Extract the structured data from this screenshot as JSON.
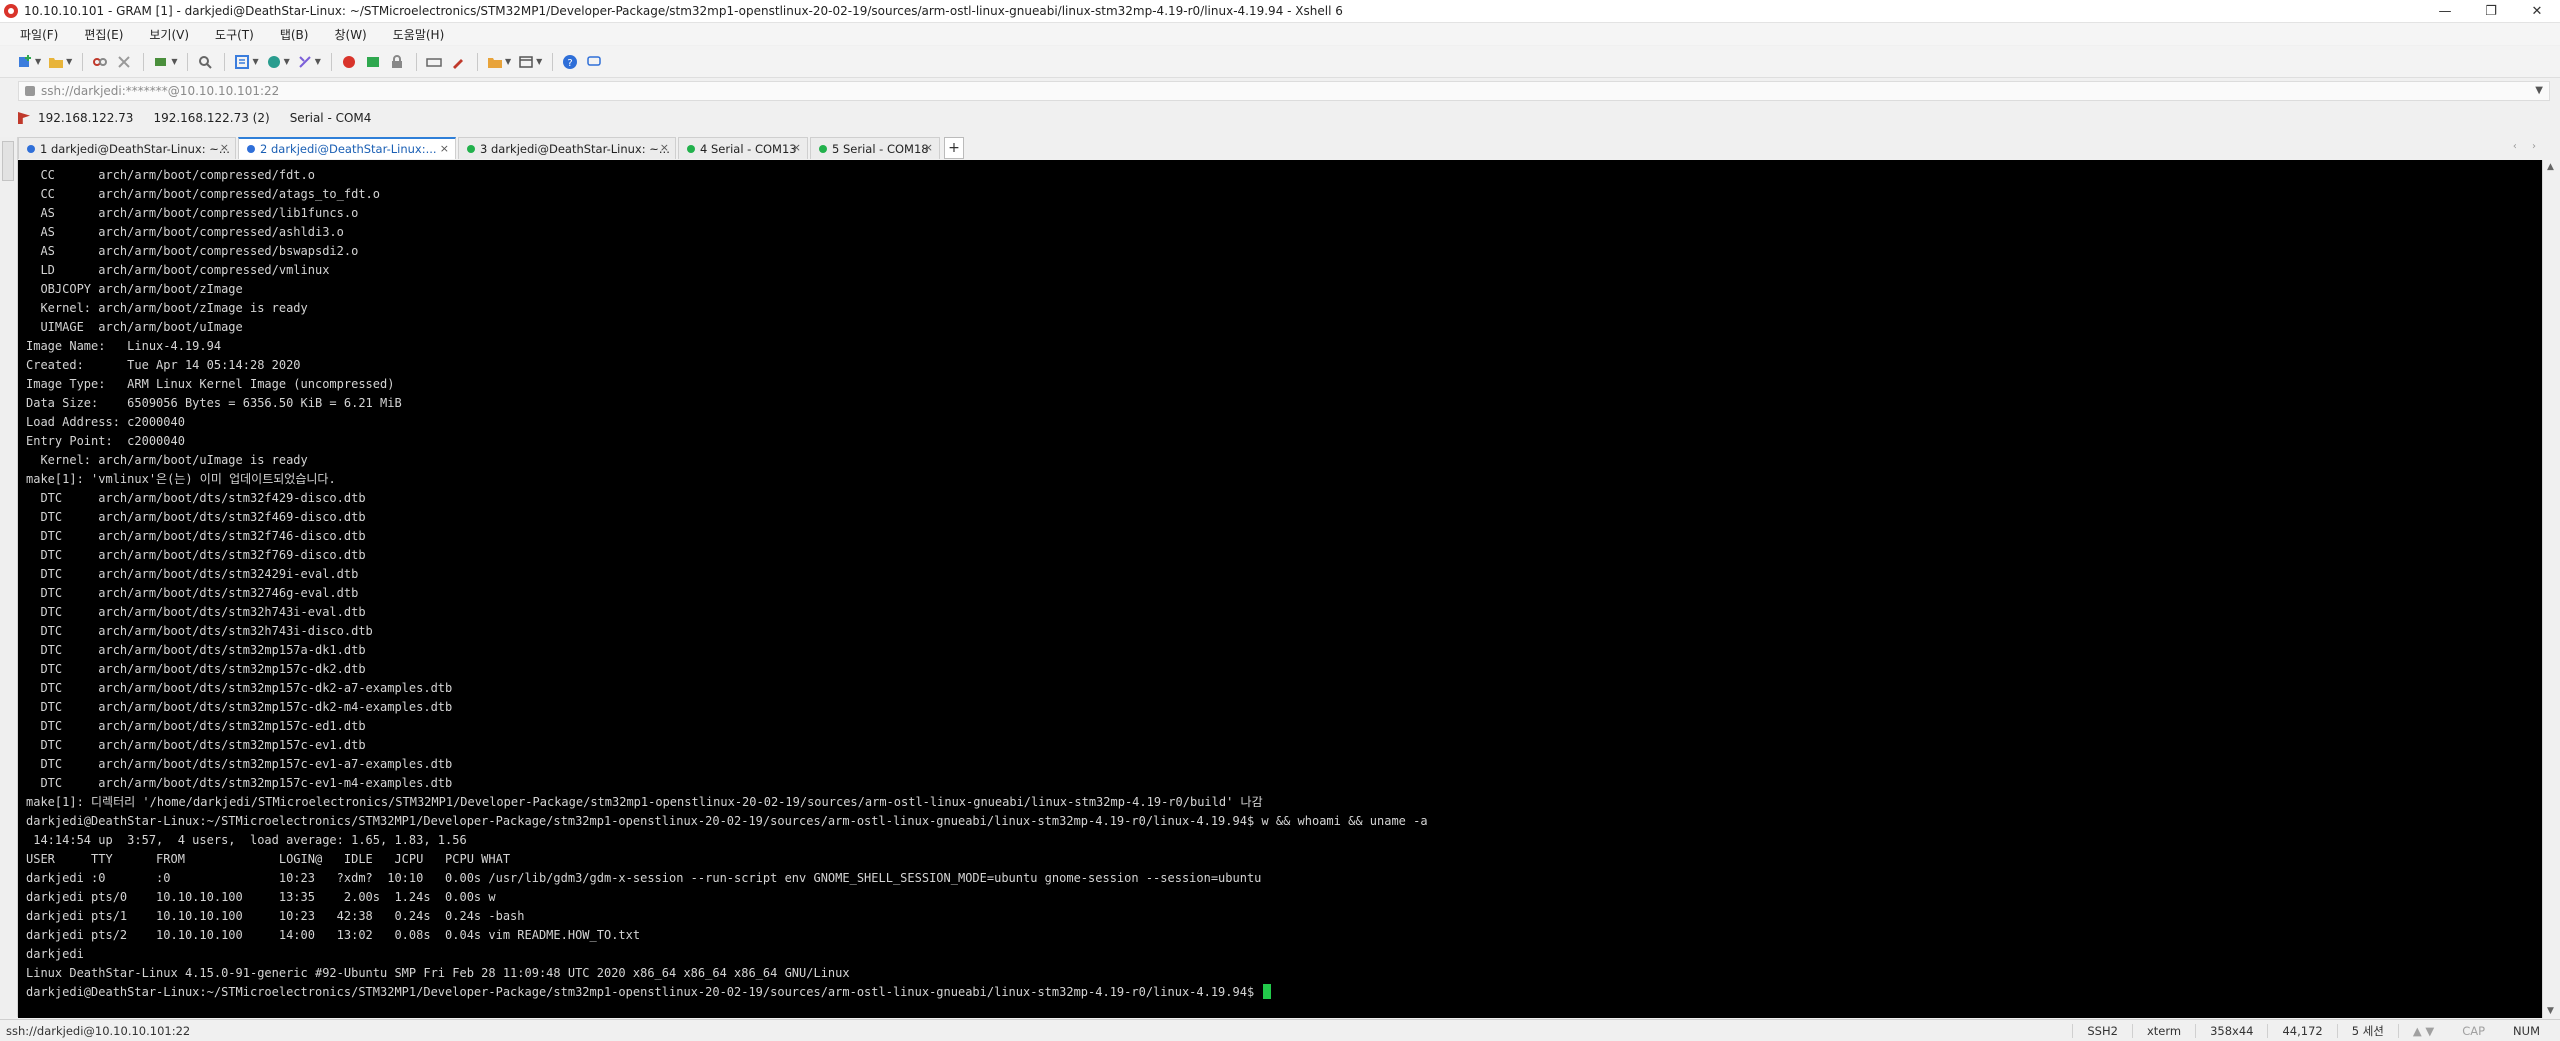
{
  "window": {
    "title": "10.10.10.101 - GRAM [1] - darkjedi@DeathStar-Linux: ~/STMicroelectronics/STM32MP1/Developer-Package/stm32mp1-openstlinux-20-02-19/sources/arm-ostl-linux-gnueabi/linux-stm32mp-4.19-r0/linux-4.19.94 - Xshell 6",
    "controls": {
      "minimize": "—",
      "maximize": "❐",
      "close": "✕"
    }
  },
  "menu": {
    "items": [
      "파일(F)",
      "편집(E)",
      "보기(V)",
      "도구(T)",
      "탭(B)",
      "창(W)",
      "도움말(H)"
    ]
  },
  "address": {
    "value": "ssh://darkjedi:*******@10.10.10.101:22"
  },
  "links": {
    "items": [
      "192.168.122.73",
      "192.168.122.73 (2)",
      "Serial - COM4"
    ]
  },
  "tabs": [
    {
      "label": "1 darkjedi@DeathStar-Linux: ~...",
      "close": "×",
      "dot": "blue"
    },
    {
      "label": "2 darkjedi@DeathStar-Linux:...",
      "close": "×",
      "dot": "blue"
    },
    {
      "label": "3 darkjedi@DeathStar-Linux: ~...",
      "close": "×",
      "dot": "green"
    },
    {
      "label": "4 Serial - COM13",
      "close": "×",
      "dot": "green"
    },
    {
      "label": "5 Serial - COM18",
      "close": "×",
      "dot": "green"
    }
  ],
  "tab_add": "+",
  "tab_scroll": "‹ ›",
  "terminal": {
    "lines": [
      "  CC      arch/arm/boot/compressed/fdt.o",
      "  CC      arch/arm/boot/compressed/atags_to_fdt.o",
      "  AS      arch/arm/boot/compressed/lib1funcs.o",
      "  AS      arch/arm/boot/compressed/ashldi3.o",
      "  AS      arch/arm/boot/compressed/bswapsdi2.o",
      "  LD      arch/arm/boot/compressed/vmlinux",
      "  OBJCOPY arch/arm/boot/zImage",
      "  Kernel: arch/arm/boot/zImage is ready",
      "  UIMAGE  arch/arm/boot/uImage",
      "Image Name:   Linux-4.19.94",
      "Created:      Tue Apr 14 05:14:28 2020",
      "Image Type:   ARM Linux Kernel Image (uncompressed)",
      "Data Size:    6509056 Bytes = 6356.50 KiB = 6.21 MiB",
      "Load Address: c2000040",
      "Entry Point:  c2000040",
      "  Kernel: arch/arm/boot/uImage is ready",
      "make[1]: 'vmlinux'은(는) 이미 업데이트되었습니다.",
      "  DTC     arch/arm/boot/dts/stm32f429-disco.dtb",
      "  DTC     arch/arm/boot/dts/stm32f469-disco.dtb",
      "  DTC     arch/arm/boot/dts/stm32f746-disco.dtb",
      "  DTC     arch/arm/boot/dts/stm32f769-disco.dtb",
      "  DTC     arch/arm/boot/dts/stm32429i-eval.dtb",
      "  DTC     arch/arm/boot/dts/stm32746g-eval.dtb",
      "  DTC     arch/arm/boot/dts/stm32h743i-eval.dtb",
      "  DTC     arch/arm/boot/dts/stm32h743i-disco.dtb",
      "  DTC     arch/arm/boot/dts/stm32mp157a-dk1.dtb",
      "  DTC     arch/arm/boot/dts/stm32mp157c-dk2.dtb",
      "  DTC     arch/arm/boot/dts/stm32mp157c-dk2-a7-examples.dtb",
      "  DTC     arch/arm/boot/dts/stm32mp157c-dk2-m4-examples.dtb",
      "  DTC     arch/arm/boot/dts/stm32mp157c-ed1.dtb",
      "  DTC     arch/arm/boot/dts/stm32mp157c-ev1.dtb",
      "  DTC     arch/arm/boot/dts/stm32mp157c-ev1-a7-examples.dtb",
      "  DTC     arch/arm/boot/dts/stm32mp157c-ev1-m4-examples.dtb",
      "make[1]: 디렉터리 '/home/darkjedi/STMicroelectronics/STM32MP1/Developer-Package/stm32mp1-openstlinux-20-02-19/sources/arm-ostl-linux-gnueabi/linux-stm32mp-4.19-r0/build' 나감",
      "darkjedi@DeathStar-Linux:~/STMicroelectronics/STM32MP1/Developer-Package/stm32mp1-openstlinux-20-02-19/sources/arm-ostl-linux-gnueabi/linux-stm32mp-4.19-r0/linux-4.19.94$ w && whoami && uname -a",
      " 14:14:54 up  3:57,  4 users,  load average: 1.65, 1.83, 1.56",
      "USER     TTY      FROM             LOGIN@   IDLE   JCPU   PCPU WHAT",
      "darkjedi :0       :0               10:23   ?xdm?  10:10   0.00s /usr/lib/gdm3/gdm-x-session --run-script env GNOME_SHELL_SESSION_MODE=ubuntu gnome-session --session=ubuntu",
      "darkjedi pts/0    10.10.10.100     13:35    2.00s  1.24s  0.00s w",
      "darkjedi pts/1    10.10.10.100     10:23   42:38   0.24s  0.24s -bash",
      "darkjedi pts/2    10.10.10.100     14:00   13:02   0.08s  0.04s vim README.HOW_TO.txt",
      "darkjedi",
      "Linux DeathStar-Linux 4.15.0-91-generic #92-Ubuntu SMP Fri Feb 28 11:09:48 UTC 2020 x86_64 x86_64 x86_64 GNU/Linux",
      "darkjedi@DeathStar-Linux:~/STMicroelectronics/STM32MP1/Developer-Package/stm32mp1-openstlinux-20-02-19/sources/arm-ostl-linux-gnueabi/linux-stm32mp-4.19-r0/linux-4.19.94$ "
    ],
    "cursor_color": "#22c94a"
  },
  "status": {
    "connection": "ssh://darkjedi@10.10.10.101:22",
    "protocol": "SSH2",
    "term": "xterm",
    "size": "358x44",
    "cursor_pos": "44,172",
    "sessions": "5 세션",
    "arrows": "▲ ▼",
    "cap": "CAP",
    "num": "NUM"
  },
  "colors": {
    "terminal_bg": "#000000",
    "terminal_fg": "#d4d4d4",
    "active_tab_accent": "#2f7fd8",
    "app_icon": "#d9342b"
  }
}
